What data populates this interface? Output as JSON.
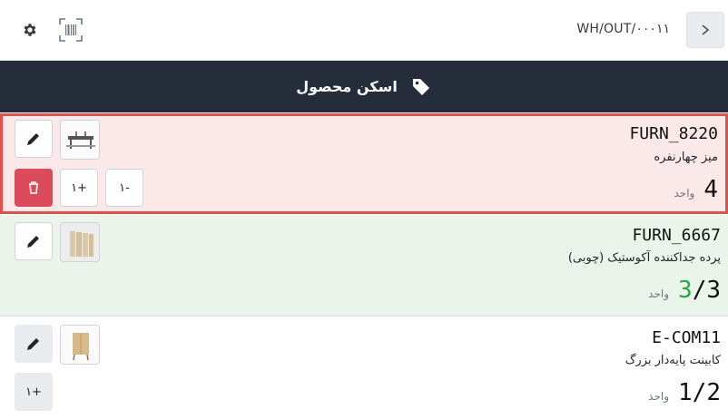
{
  "header": {
    "reference": "WH/OUT/۰۰۰۱۱"
  },
  "band": {
    "title": "اسکن محصول"
  },
  "lines": [
    {
      "code": "FURN_8220",
      "name": "میز چهارنفره",
      "qty_done": "",
      "qty_total": "4",
      "unit": "واحد",
      "minus_label": "۱-",
      "plus_label": "۱+"
    },
    {
      "code": "FURN_6667",
      "name": "پرده جداکننده آکوستیک (چوبی)",
      "qty_done": "3",
      "qty_total": "/3",
      "unit": "واحد"
    },
    {
      "code": "E-COM11",
      "name": "کابینت پایه‌دار بزرگ",
      "qty_done": "",
      "qty_total": "1/2",
      "unit": "واحد",
      "plus_label": "۱+"
    }
  ],
  "colors": {
    "header_band": "#252d3a",
    "row_error_bg": "#fbe9ea",
    "row_error_border": "#d9534f",
    "row_done_bg": "#eaf4ea",
    "qty_done": "#28a745",
    "delete_button": "#dc4b5b"
  },
  "icons": [
    "gear-icon",
    "barcode-icon",
    "chevron-right-icon",
    "tag-icon",
    "pencil-icon",
    "trash-icon"
  ]
}
